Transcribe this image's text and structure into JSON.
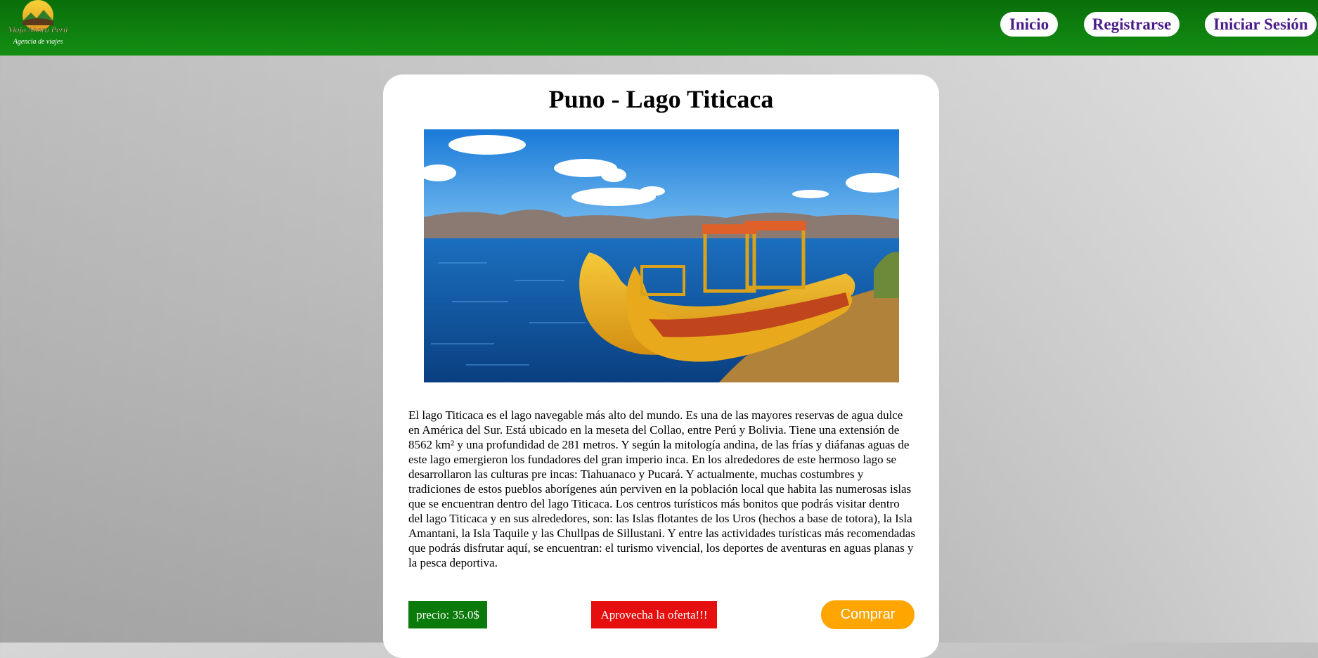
{
  "header": {
    "logo_text_line1": "Viaja Ahora Perú",
    "logo_text_line2": "Agencia de viajes",
    "nav": {
      "inicio": "Inicio",
      "registrarse": "Registrarse",
      "iniciar_sesion": "Iniciar Sesión"
    }
  },
  "tour": {
    "title": "Puno - Lago Titicaca",
    "description": "El lago Titicaca es el lago navegable más alto del mundo. Es una de las mayores reservas de agua dulce en América del Sur. Está ubicado en la meseta del Collao, entre Perú y Bolivia. Tiene una extensión de 8562 km² y una profundidad de 281 metros. Y según la mitología andina, de las frías y diáfanas aguas de este lago emergieron los fundadores del gran imperio inca. En los alrededores de este hermoso lago se desarrollaron las culturas pre incas: Tiahuanaco y Pucará. Y actualmente, muchas costumbres y tradiciones de estos pueblos aborígenes aún perviven en la población local que habita las numerosas islas que se encuentran dentro del lago Titicaca. Los centros turísticos más bonitos que podrás visitar dentro del lago Titicaca y en sus alrededores, son: las Islas flotantes de los Uros (hechos a base de totora), la Isla Amantani, la Isla Taquile y las Chullpas de Sillustani. Y entre las actividades turísticas más recomendadas que podrás disfrutar aquí, se encuentran: el turismo vivencial, los deportes de aventuras en aguas planas y la pesca deportiva.",
    "price": "precio: 35.0$",
    "offer": "Aprovecha la oferta!!!",
    "buy": "Comprar"
  },
  "colors": {
    "header_green": "#0a7a0a",
    "nav_text": "#4b1d8a",
    "price_bg": "#0a7a0a",
    "offer_bg": "#e50f0f",
    "buy_bg": "#ffa500"
  }
}
